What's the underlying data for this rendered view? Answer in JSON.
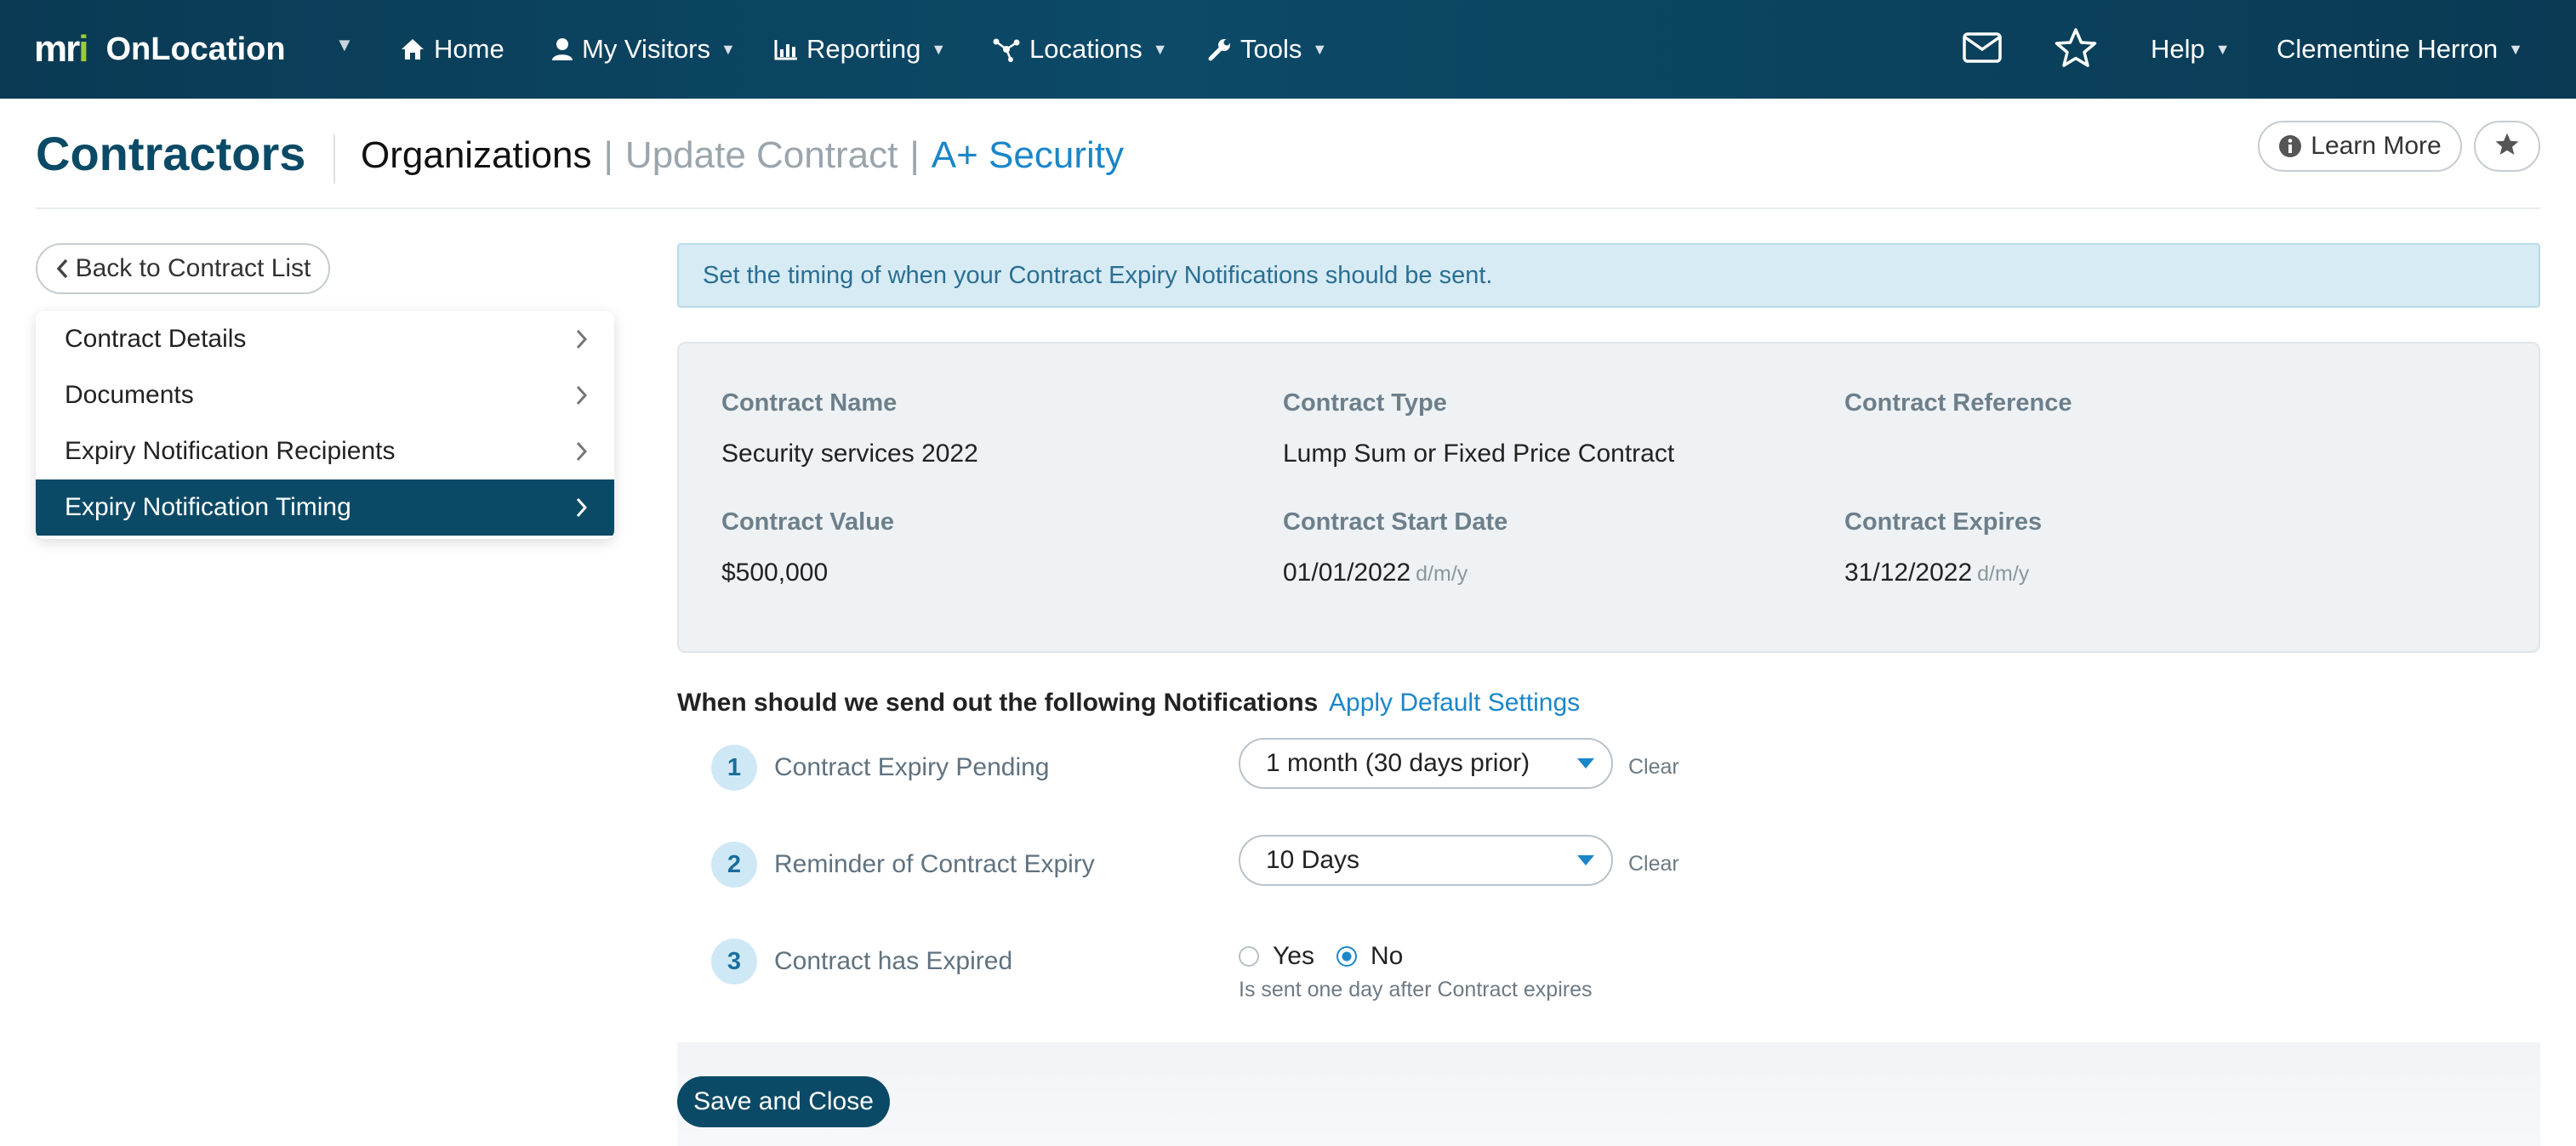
{
  "brand": {
    "logo": "mri",
    "name": "OnLocation"
  },
  "nav": {
    "home": "Home",
    "visitors": "My Visitors",
    "reporting": "Reporting",
    "locations": "Locations",
    "tools": "Tools",
    "help": "Help",
    "user": "Clementine Herron"
  },
  "header": {
    "title": "Contractors",
    "breadcrumb": [
      "Organizations",
      "Update Contract",
      "A+ Security"
    ],
    "separator": "|",
    "learn_more": "Learn More"
  },
  "sidebar": {
    "back": "Back to Contract List",
    "items": [
      {
        "label": "Contract Details"
      },
      {
        "label": "Documents"
      },
      {
        "label": "Expiry Notification Recipients"
      },
      {
        "label": "Expiry Notification Timing"
      }
    ],
    "active_index": 3
  },
  "main": {
    "alert": "Set the timing of when your Contract Expiry Notifications should be sent.",
    "summary": {
      "name_label": "Contract Name",
      "name": "Security services 2022",
      "type_label": "Contract Type",
      "type": "Lump Sum or Fixed Price Contract",
      "ref_label": "Contract Reference",
      "ref": "",
      "value_label": "Contract Value",
      "value": "$500,000",
      "start_label": "Contract Start Date",
      "start": "01/01/2022",
      "expires_label": "Contract Expires",
      "expires": "31/12/2022",
      "date_format": "d/m/y"
    },
    "question": "When should we send out the following Notifications",
    "apply_defaults": "Apply Default Settings",
    "notifications": [
      {
        "num": "1",
        "label": "Contract Expiry Pending",
        "value": "1 month (30 days prior)",
        "clear": "Clear"
      },
      {
        "num": "2",
        "label": "Reminder of Contract Expiry",
        "value": "10 Days",
        "clear": "Clear"
      },
      {
        "num": "3",
        "label": "Contract has Expired",
        "yes": "Yes",
        "no": "No",
        "selected": "No",
        "hint": "Is sent one day after Contract expires"
      }
    ],
    "save": "Save and Close"
  },
  "colors": {
    "nav_bg": "#0a3a54",
    "accent": "#1a86c8",
    "primary": "#0b4a66",
    "alert_bg": "#d7ebf4"
  }
}
